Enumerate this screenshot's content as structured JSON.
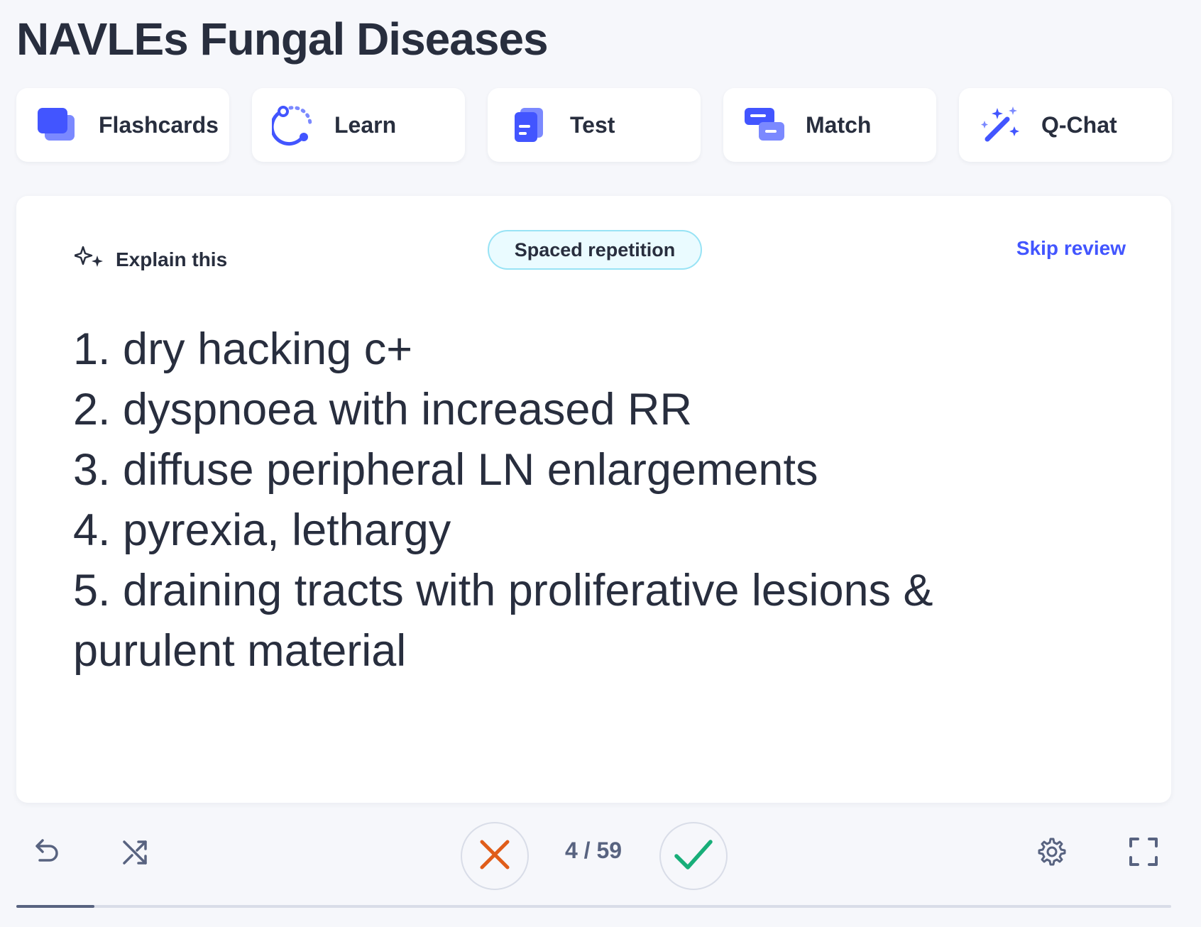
{
  "page": {
    "title": "NAVLEs Fungal Diseases"
  },
  "modes": [
    {
      "label": "Flashcards",
      "icon": "flashcards-icon"
    },
    {
      "label": "Learn",
      "icon": "learn-icon"
    },
    {
      "label": "Test",
      "icon": "test-icon"
    },
    {
      "label": "Match",
      "icon": "match-icon"
    },
    {
      "label": "Q-Chat",
      "icon": "magic-wand-icon"
    }
  ],
  "card": {
    "explain_label": "Explain this",
    "badge": "Spaced repetition",
    "skip_label": "Skip review",
    "lines": [
      "1. dry hacking c+",
      "2. dyspnoea with increased RR",
      "3. diffuse peripheral LN enlargements",
      "4. pyrexia, lethargy",
      "5. draining tracts with proliferative lesions &",
      "purulent material"
    ]
  },
  "controls": {
    "counter": "4 / 59",
    "icons": [
      "undo-icon",
      "shuffle-icon",
      "incorrect-x-icon",
      "correct-check-icon",
      "gear-icon",
      "fullscreen-icon"
    ]
  },
  "progress": {
    "current": 4,
    "total": 59
  },
  "colors": {
    "accent": "#4255ff",
    "incorrect": "#e05d1a",
    "correct": "#18ae79",
    "badge_bg": "#eafbff",
    "badge_border": "#98e3f5"
  }
}
